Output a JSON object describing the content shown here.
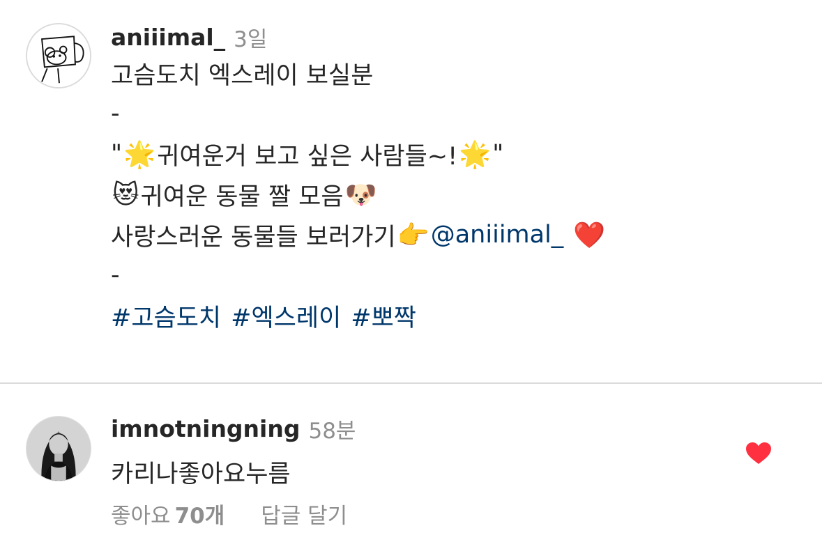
{
  "post": {
    "username": "aniiimal_",
    "time": "3일",
    "lines": {
      "line1": "고슴도치 엑스레이 보실분",
      "dash1": "-",
      "quote_open": "\"",
      "line3_text": "귀여운거 보고 싶은 사람들~!",
      "quote_close": "\"",
      "line4_text": "귀여운 동물 짤 모음",
      "line5_text": "사랑스러운 동물들 보러가기",
      "mention": "@aniiimal_",
      "dash2": "-"
    },
    "emojis": {
      "star": "🌟",
      "cat": "😻",
      "dog": "🐶",
      "point": "👉",
      "heart": "❤️"
    },
    "hashtags": [
      "#고슴도치",
      "#엑스레이",
      "#뽀짝"
    ]
  },
  "comment": {
    "username": "imnotningning",
    "time": "58분",
    "text": "카리나좋아요누름",
    "likes_label": "좋아요",
    "likes_count": "70개",
    "reply_label": "답글 달기",
    "liked": true,
    "heart_color": "#ff3040"
  }
}
